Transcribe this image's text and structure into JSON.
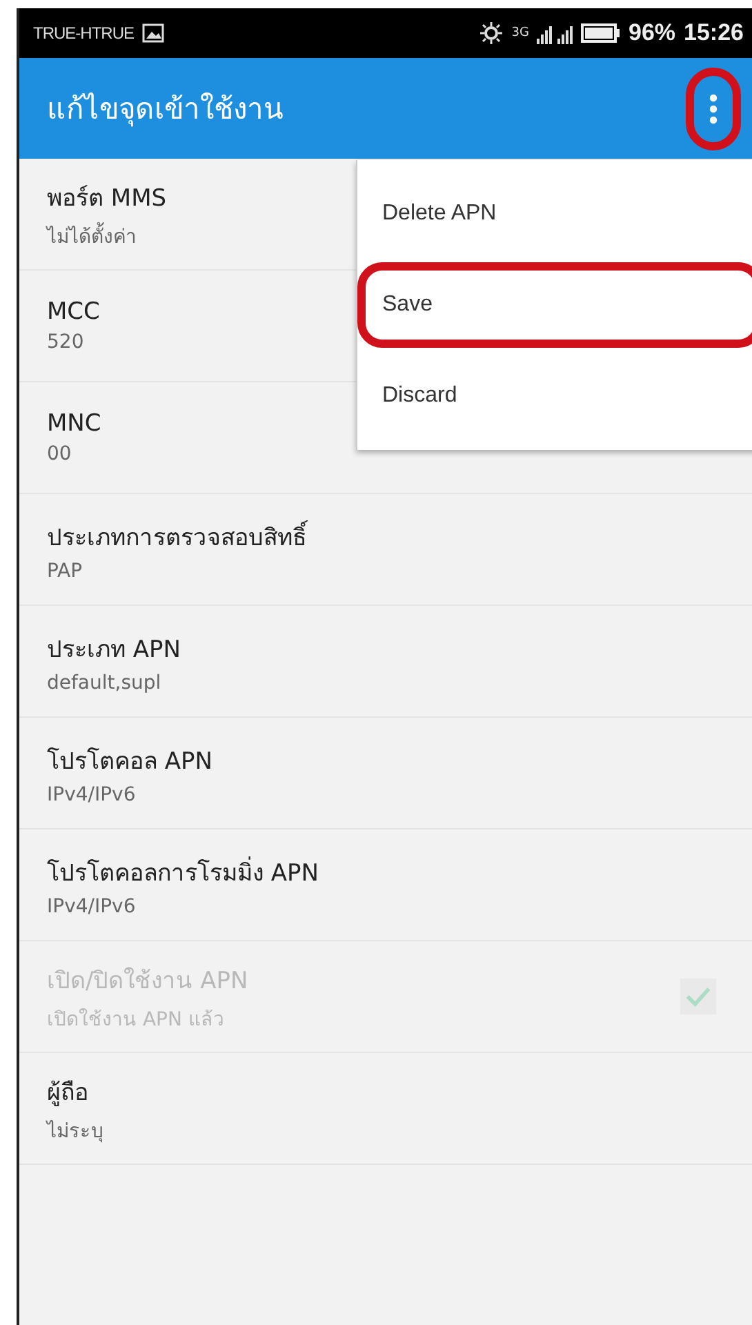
{
  "status_bar": {
    "carrier": "TRUE-HTRUE",
    "network": "3G",
    "battery": "96%",
    "time": "15:26"
  },
  "app_bar": {
    "title": "แก้ไขจุดเข้าใช้งาน",
    "overflow_highlighted": true
  },
  "settings": [
    {
      "kind": "text",
      "title": "พอร์ต MMS",
      "value": "ไม่ได้ตั้งค่า",
      "disabled": false
    },
    {
      "kind": "text",
      "title": "MCC",
      "value": "520",
      "disabled": false
    },
    {
      "kind": "text",
      "title": "MNC",
      "value": "00",
      "disabled": false
    },
    {
      "kind": "text",
      "title": "ประเภทการตรวจสอบสิทธิ์",
      "value": "PAP",
      "disabled": false
    },
    {
      "kind": "text",
      "title": "ประเภท APN",
      "value": "default,supl",
      "disabled": false
    },
    {
      "kind": "text",
      "title": "โปรโตคอล APN",
      "value": "IPv4/IPv6",
      "disabled": false
    },
    {
      "kind": "text",
      "title": "โปรโตคอลการโรมมิ่ง APN",
      "value": "IPv4/IPv6",
      "disabled": false
    },
    {
      "kind": "checkbox",
      "title": "เปิด/ปิดใช้งาน APN",
      "value": "เปิดใช้งาน APN แล้ว",
      "disabled": true,
      "checked": true
    },
    {
      "kind": "text",
      "title": "ผู้ถือ",
      "value": "ไม่ระบุ",
      "disabled": false
    }
  ],
  "menu": [
    {
      "label": "Delete APN",
      "highlighted": false
    },
    {
      "label": "Save",
      "highlighted": true
    },
    {
      "label": "Discard",
      "highlighted": false
    }
  ]
}
